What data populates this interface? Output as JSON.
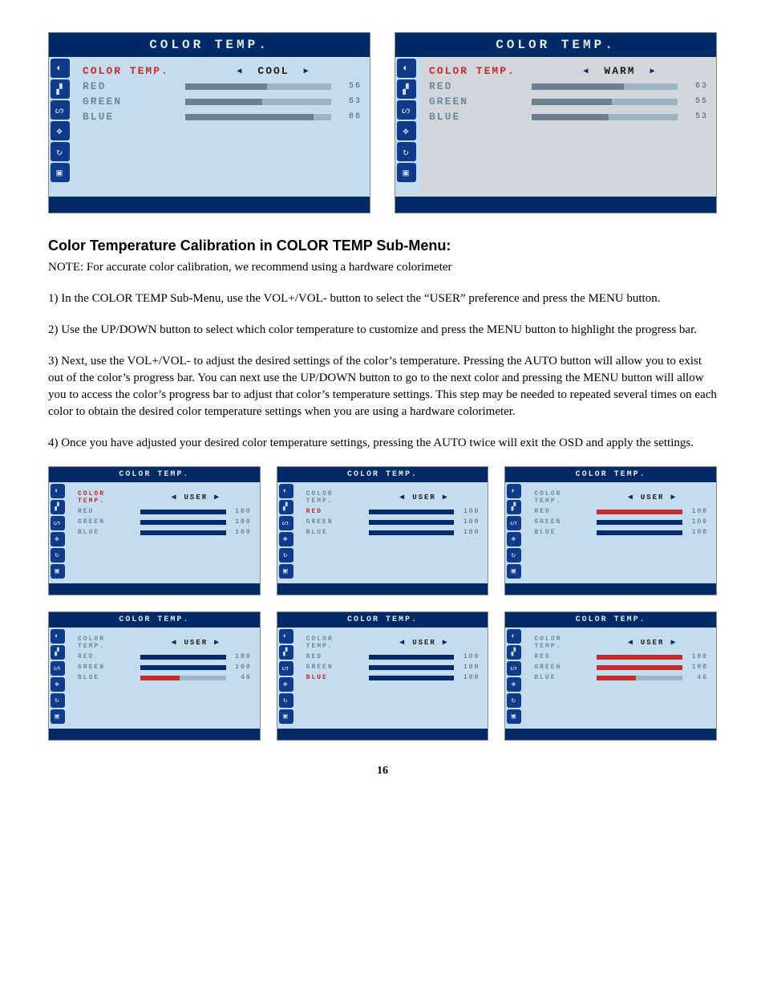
{
  "page_number": "16",
  "section_heading": "Color Temperature Calibration in COLOR TEMP Sub-Menu:",
  "note": "NOTE: For accurate color calibration, we recommend using a hardware colorimeter",
  "step1": "1) In the COLOR TEMP Sub-Menu, use the VOL+/VOL- button to select the “USER” preference and press the MENU button.",
  "step2": "2) Use the UP/DOWN button to select which color temperature to customize and press the MENU button to highlight the progress bar.",
  "step3": "3) Next, use the VOL+/VOL- to adjust the desired settings of the color’s temperature. Pressing the AUTO button will allow you to exist out of the color’s progress bar. You can next use the UP/DOWN button to go to the next color and pressing the MENU button will allow you to access the color’s progress bar to adjust that color’s temperature settings. This step may be needed to repeated several times on each color to obtain the desired color temperature settings when you are using a hardware colorimeter.",
  "step4": "4) Once you have adjusted your desired color temperature settings, pressing the AUTO twice will exit the OSD and apply the settings.",
  "osd_title": "COLOR TEMP.",
  "labels": {
    "color_temp": "COLOR TEMP.",
    "red": "RED",
    "green": "GREEN",
    "blue": "BLUE"
  },
  "selector": {
    "cool": "COOL",
    "warm": "WARM",
    "user": "USER"
  },
  "top_panels": [
    {
      "preset": "COOL",
      "red": 56,
      "green": 53,
      "blue": 88,
      "style": "gray"
    },
    {
      "preset": "WARM",
      "red": 63,
      "green": 55,
      "blue": 53,
      "style": "gray"
    }
  ],
  "small_panels": [
    {
      "preset": "USER",
      "red": {
        "v": 100,
        "hl": false
      },
      "green": {
        "v": 100,
        "hl": false
      },
      "blue": {
        "v": 100,
        "hl": false
      },
      "active": "ct"
    },
    {
      "preset": "USER",
      "red": {
        "v": 100,
        "hl": false
      },
      "green": {
        "v": 100,
        "hl": false
      },
      "blue": {
        "v": 100,
        "hl": false
      },
      "active": "red"
    },
    {
      "preset": "USER",
      "red": {
        "v": 100,
        "hl": true
      },
      "green": {
        "v": 100,
        "hl": false
      },
      "blue": {
        "v": 100,
        "hl": false
      },
      "active": "none"
    },
    {
      "preset": "USER",
      "red": {
        "v": 100,
        "hl": false
      },
      "green": {
        "v": 100,
        "hl": false
      },
      "blue": {
        "v": 46,
        "hl": true
      },
      "active": "none"
    },
    {
      "preset": "USER",
      "red": {
        "v": 100,
        "hl": false
      },
      "green": {
        "v": 100,
        "hl": false
      },
      "blue": {
        "v": 100,
        "hl": false
      },
      "active": "blue"
    },
    {
      "preset": "USER",
      "red": {
        "v": 100,
        "hl": true
      },
      "green": {
        "v": 100,
        "hl": true
      },
      "blue": {
        "v": 46,
        "hl": true
      },
      "active": "none"
    }
  ]
}
